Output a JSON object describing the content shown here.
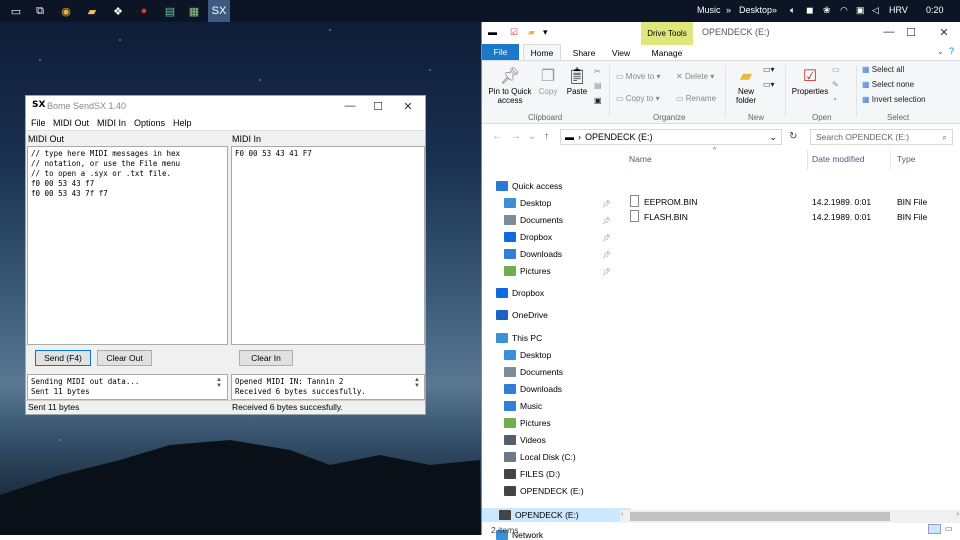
{
  "taskbar": {
    "items": [
      "task-view",
      "chrome",
      "file-explorer",
      "app-1",
      "app-2",
      "app-3",
      "app-4",
      "sendsx"
    ],
    "tray_music": "Music",
    "tray_desktop": "Desktop",
    "tray_lang": "HRV",
    "tray_time": "0:20"
  },
  "sendsx": {
    "logo": "SX",
    "title": "Bome SendSX 1.40",
    "menu": [
      "File",
      "MIDI Out",
      "MIDI In",
      "Options",
      "Help"
    ],
    "midi_out_label": "MIDI Out",
    "midi_in_label": "MIDI In",
    "midi_out_text": "// type here MIDI messages in hex\n// notation, or use the File menu\n// to open a .syx or .txt file.\nf0 00 53 43 f7\nf0 00 53 43 7f f7",
    "midi_in_text": "F0 00 53 43 41 F7",
    "send_button": "Send (F4)",
    "clear_out_button": "Clear Out",
    "clear_in_button": "Clear In",
    "log_out": "Sending MIDI out data...\nSent 11 bytes",
    "log_in": "Opened MIDI IN: Tannin 2\nReceived 6 bytes succesfully.",
    "status_out": "Sent 11 bytes",
    "status_in": "Received 6 bytes succesfully."
  },
  "explorer": {
    "drive_tools": "Drive Tools",
    "title": "OPENDECK (E:)",
    "tabs": [
      "File",
      "Home",
      "Share",
      "View",
      "Manage"
    ],
    "ribbon": {
      "pin": "Pin to Quick\naccess",
      "copy": "Copy",
      "paste": "Paste",
      "move_to": "Move to",
      "copy_to": "Copy to",
      "delete": "Delete",
      "rename": "Rename",
      "new_folder": "New\nfolder",
      "properties": "Properties",
      "select_all": "Select all",
      "select_none": "Select none",
      "invert_selection": "Invert selection",
      "groups": [
        "Clipboard",
        "Organize",
        "New",
        "Open",
        "Select"
      ]
    },
    "address": "OPENDECK (E:)",
    "search_placeholder": "Search OPENDECK (E:)",
    "nav": [
      {
        "label": "Quick access",
        "icon": "star-icon",
        "color": "#2b79d6"
      },
      {
        "label": "Desktop",
        "icon": "desktop-icon",
        "color": "#3b8ed8",
        "pinned": true
      },
      {
        "label": "Documents",
        "icon": "documents-icon",
        "color": "#7d8c9a",
        "pinned": true
      },
      {
        "label": "Dropbox",
        "icon": "dropbox-icon",
        "color": "#0d6ae0",
        "pinned": true
      },
      {
        "label": "Downloads",
        "icon": "downloads-icon",
        "color": "#2f7fd6",
        "pinned": true
      },
      {
        "label": "Pictures",
        "icon": "pictures-icon",
        "color": "#6fae4c",
        "pinned": true
      },
      {
        "label": "Dropbox",
        "icon": "dropbox-icon",
        "color": "#0d6ae0"
      },
      {
        "label": "OneDrive",
        "icon": "onedrive-icon",
        "color": "#1a62c4"
      },
      {
        "label": "This PC",
        "icon": "pc-icon",
        "color": "#3d8fd6"
      },
      {
        "label": "Desktop",
        "icon": "desktop-icon",
        "color": "#3b8ed8"
      },
      {
        "label": "Documents",
        "icon": "documents-icon",
        "color": "#7d8c9a"
      },
      {
        "label": "Downloads",
        "icon": "downloads-icon",
        "color": "#2f7fd6"
      },
      {
        "label": "Music",
        "icon": "music-icon",
        "color": "#2f7fd6"
      },
      {
        "label": "Pictures",
        "icon": "pictures-icon",
        "color": "#6fae4c"
      },
      {
        "label": "Videos",
        "icon": "videos-icon",
        "color": "#555f6b"
      },
      {
        "label": "Local Disk (C:)",
        "icon": "drive-icon",
        "color": "#6c7a88"
      },
      {
        "label": "FILES (D:)",
        "icon": "drive-icon",
        "color": "#444"
      },
      {
        "label": "OPENDECK (E:)",
        "icon": "drive-icon",
        "color": "#444"
      },
      {
        "label": "OPENDECK (E:)",
        "icon": "drive-icon",
        "color": "#444",
        "selected": true
      },
      {
        "label": "Network",
        "icon": "network-icon",
        "color": "#3d8fd6"
      }
    ],
    "columns": [
      "Name",
      "Date modified",
      "Type"
    ],
    "files": [
      {
        "name": "EEPROM.BIN",
        "date": "14.2.1989. 0:01",
        "type": "BIN File"
      },
      {
        "name": "FLASH.BIN",
        "date": "14.2.1989. 0:01",
        "type": "BIN File"
      }
    ],
    "status": "2 items"
  }
}
